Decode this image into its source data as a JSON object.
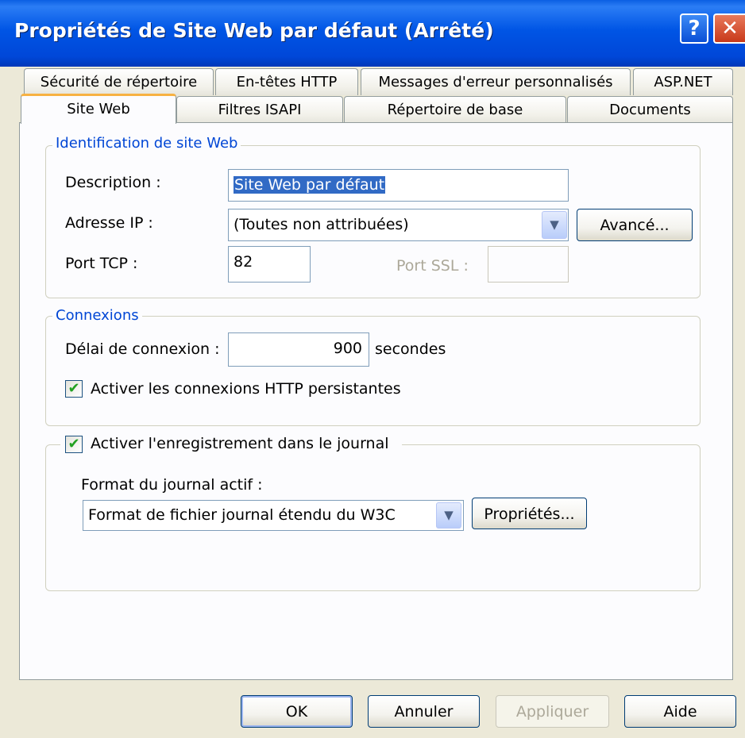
{
  "window": {
    "title": "Propriétés de Site Web par défaut (Arrêté)",
    "help_label": "?",
    "close_label": "✕"
  },
  "tabs": {
    "row1": [
      "Sécurité de répertoire",
      "En-têtes HTTP",
      "Messages d'erreur personnalisés",
      "ASP.NET"
    ],
    "row2": [
      "Site Web",
      "Filtres ISAPI",
      "Répertoire de base",
      "Documents"
    ],
    "active": "Site Web"
  },
  "identification": {
    "legend": "Identification de site Web",
    "description_label": "Description :",
    "description_value": "Site Web par défaut",
    "ip_label": "Adresse IP :",
    "ip_value": "(Toutes non attribuées)",
    "advanced_button": "Avancé...",
    "tcp_label": "Port TCP :",
    "tcp_value": "82",
    "ssl_label": "Port SSL :",
    "ssl_value": ""
  },
  "connections": {
    "legend": "Connexions",
    "timeout_label": "Délai de connexion :",
    "timeout_value": "900",
    "timeout_unit": "secondes",
    "keepalive_label": "Activer les connexions HTTP persistantes",
    "keepalive_checked": true
  },
  "logging": {
    "enable_label": "Activer l'enregistrement dans le journal",
    "enable_checked": true,
    "format_label": "Format du journal actif :",
    "format_value": "Format de fichier journal étendu du W3C",
    "properties_button": "Propriétés..."
  },
  "footer": {
    "ok": "OK",
    "cancel": "Annuler",
    "apply": "Appliquer",
    "help": "Aide"
  },
  "icons": {
    "check": "✔",
    "dropdown": "▼"
  },
  "colors": {
    "title_bar": "#0055e5",
    "legend_text": "#0046d5",
    "active_tab_accent": "#f7b142",
    "selection": "#316ac5"
  }
}
